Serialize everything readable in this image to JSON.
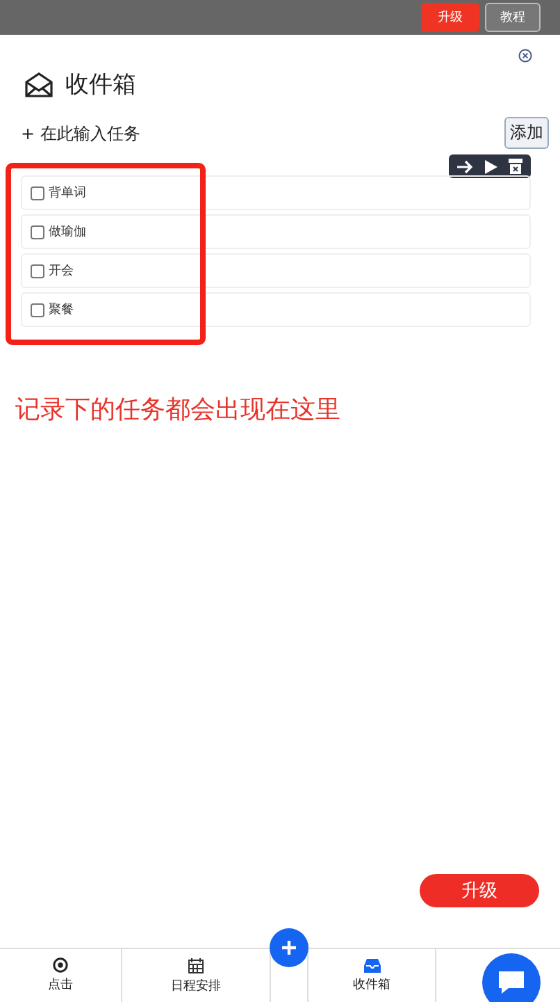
{
  "top_bar": {
    "buttons": [
      {
        "label": "升级",
        "kind": "primary"
      },
      {
        "label": "教程",
        "kind": "outline"
      }
    ]
  },
  "inbox": {
    "title": "收件箱",
    "input": {
      "placeholder": "+ 在此输入任务"
    },
    "add_button": "添加",
    "tasks": [
      {
        "label": "背单词",
        "checked": false
      },
      {
        "label": "做瑜伽",
        "checked": false
      },
      {
        "label": "开会",
        "checked": false
      },
      {
        "label": "聚餐",
        "checked": false
      }
    ]
  },
  "annotation": "记录下的任务都会出现在这里",
  "upgrade_button": "升级",
  "bottom_nav": [
    {
      "label": "点击",
      "kind": "target"
    },
    {
      "label": "日程安排",
      "kind": "calendar"
    },
    {
      "kind": "plus"
    },
    {
      "label": "收件箱",
      "kind": "inbox"
    }
  ]
}
